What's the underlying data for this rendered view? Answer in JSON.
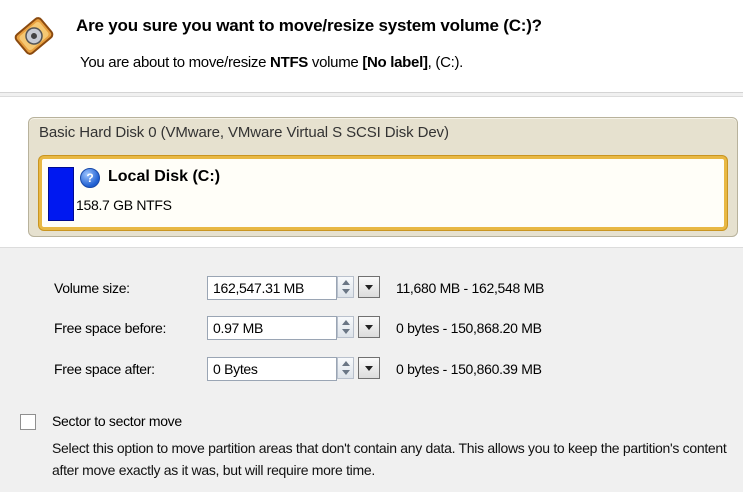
{
  "header": {
    "title": "Are you sure you want to move/resize system volume (C:)?",
    "subtitle_prefix": "You are about to move/resize ",
    "fs": "NTFS",
    "subtitle_mid": " volume ",
    "label": "[No label]",
    "subtitle_end": ", (C:)."
  },
  "disk": {
    "title": "Basic Hard Disk 0 (VMware, VMware Virtual S SCSI Disk Dev)",
    "partition": {
      "name": "Local Disk (C:)",
      "info": "158.7 GB NTFS",
      "used_fraction": 0.93
    }
  },
  "form": {
    "volume_size": {
      "label": "Volume size:",
      "value": "162,547.31 MB",
      "range": "11,680 MB - 162,548 MB"
    },
    "free_before": {
      "label": "Free space before:",
      "value": "0.97 MB",
      "range": "0 bytes - 150,868.20 MB"
    },
    "free_after": {
      "label": "Free space after:",
      "value": "0 Bytes",
      "range": "0 bytes - 150,860.39 MB"
    }
  },
  "sector_move": {
    "label": "Sector to sector move",
    "checked": false,
    "description": "Select this option to move partition areas that don't contain any data. This allows you to keep the partition's content after move exactly as it was, but will require more time."
  },
  "colors": {
    "used_bar": "#0018f0",
    "partition_border": "#e8b844",
    "disk_panel": "#e6e1cf"
  }
}
